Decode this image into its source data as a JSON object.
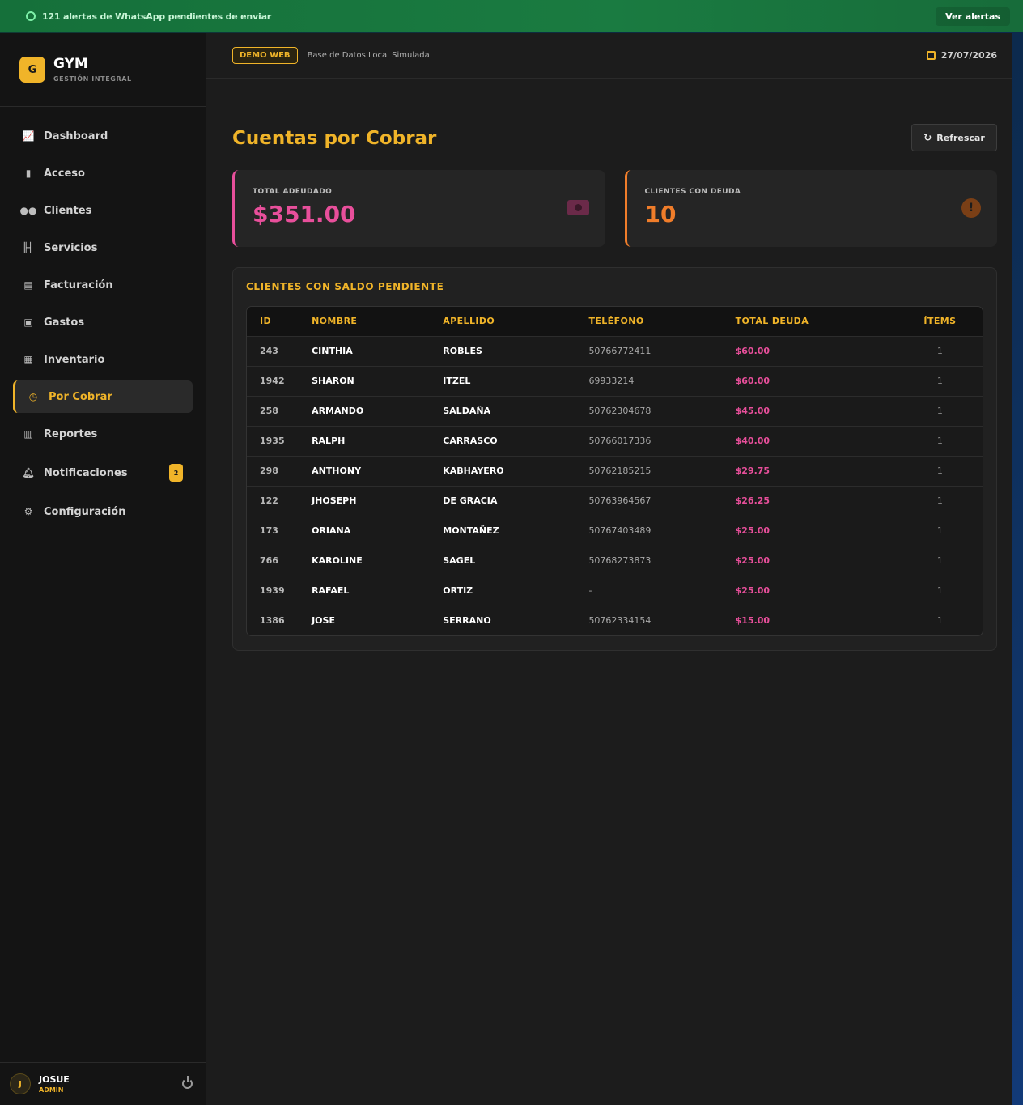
{
  "banner": {
    "text": "121 alertas de WhatsApp pendientes de enviar",
    "button": "Ver alertas"
  },
  "brand": {
    "logo_letter": "G",
    "name": "GYM",
    "subtitle": "GESTIÓN INTEGRAL"
  },
  "sidebar": {
    "items": [
      {
        "label": "Dashboard",
        "icon": "chart-line-icon"
      },
      {
        "label": "Acceso",
        "icon": "door-icon"
      },
      {
        "label": "Clientes",
        "icon": "users-icon"
      },
      {
        "label": "Servicios",
        "icon": "dumbbell-icon"
      },
      {
        "label": "Facturación",
        "icon": "invoice-icon"
      },
      {
        "label": "Gastos",
        "icon": "money-bill-icon"
      },
      {
        "label": "Inventario",
        "icon": "boxes-icon"
      },
      {
        "label": "Por Cobrar",
        "icon": "clock-icon",
        "active": true
      },
      {
        "label": "Reportes",
        "icon": "file-pdf-icon"
      },
      {
        "label": "Notificaciones",
        "icon": "bell-icon",
        "badge": "2"
      },
      {
        "label": "Configuración",
        "icon": "cogs-icon"
      }
    ]
  },
  "user": {
    "initial": "J",
    "name": "JOSUE",
    "role": "ADMIN"
  },
  "topbar": {
    "badge": "DEMO WEB",
    "db_text": "Base de Datos Local Simulada",
    "date": "27/07/2026"
  },
  "page": {
    "title": "Cuentas por Cobrar",
    "refresh_label": "Refrescar"
  },
  "stats": {
    "total_label": "TOTAL ADEUDADO",
    "total_value": "$351.00",
    "clients_label": "CLIENTES CON DEUDA",
    "clients_value": "10"
  },
  "table": {
    "title": "CLIENTES CON SALDO PENDIENTE",
    "headers": [
      "ID",
      "NOMBRE",
      "APELLIDO",
      "TELÉFONO",
      "TOTAL DEUDA",
      "ÍTEMS"
    ],
    "rows": [
      [
        "243",
        "CINTHIA",
        "ROBLES",
        "50766772411",
        "$60.00",
        "1"
      ],
      [
        "1942",
        "SHARON",
        "ITZEL",
        "69933214",
        "$60.00",
        "1"
      ],
      [
        "258",
        "ARMANDO",
        "SALDAÑA",
        "50762304678",
        "$45.00",
        "1"
      ],
      [
        "1935",
        "RALPH",
        "CARRASCO",
        "50766017336",
        "$40.00",
        "1"
      ],
      [
        "298",
        "ANTHONY",
        "KABHAYERO",
        "50762185215",
        "$29.75",
        "1"
      ],
      [
        "122",
        "JHOSEPH",
        "DE GRACIA",
        "50763964567",
        "$26.25",
        "1"
      ],
      [
        "173",
        "ORIANA",
        "MONTAÑEZ",
        "50767403489",
        "$25.00",
        "1"
      ],
      [
        "766",
        "KAROLINE",
        "SAGEL",
        "50768273873",
        "$25.00",
        "1"
      ],
      [
        "1939",
        "RAFAEL",
        "ORTIZ",
        "-",
        "$25.00",
        "1"
      ],
      [
        "1386",
        "JOSE",
        "SERRANO",
        "50762334154",
        "$15.00",
        "1"
      ]
    ]
  },
  "colors": {
    "accent": "#f0b429",
    "pink": "#e84f9b",
    "orange": "#f07d2a"
  }
}
